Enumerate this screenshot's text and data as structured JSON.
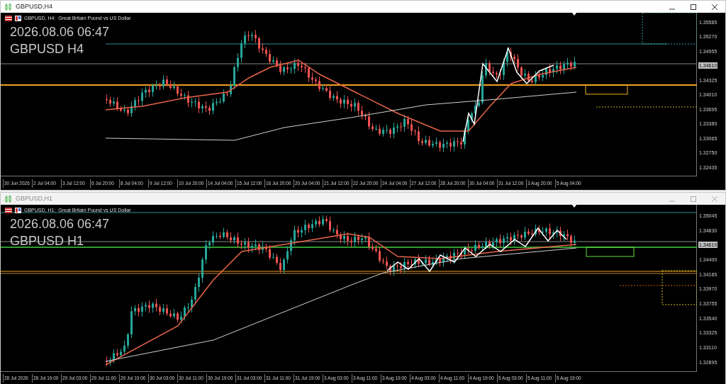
{
  "windows": [
    {
      "title": "GBPUSD,H4",
      "active": true,
      "header": "GBPUSD, H4:  Great Britain Pound vs US Dollar",
      "clock": "2026.08.06 06:47",
      "symbol_label": "GBPUSD H4",
      "price_axis": [
        {
          "kind": "tick",
          "label": "1.35585"
        },
        {
          "kind": "tick",
          "label": "1.35270"
        },
        {
          "kind": "tick",
          "label": "1.34955"
        },
        {
          "kind": "current",
          "label": "1.34610"
        },
        {
          "kind": "tick",
          "label": "1.34325"
        },
        {
          "kind": "tick",
          "label": "1.34010"
        },
        {
          "kind": "tick",
          "label": "1.33695"
        },
        {
          "kind": "tick",
          "label": "1.33380"
        },
        {
          "kind": "tick",
          "label": "1.33065"
        },
        {
          "kind": "tick",
          "label": "1.32750"
        },
        {
          "kind": "tick",
          "label": "1.32435"
        }
      ],
      "time_axis": [
        "30 Jun 2026",
        "2 Jul 04:00",
        "3 Jul 12:00",
        "6 Jul 20:00",
        "8 Jul 04:00",
        "9 Jul 12:00",
        "10 Jul 20:00",
        "14 Jul 04:00",
        "15 Jul 12:00",
        "16 Jul 20:00",
        "20 Jul 04:00",
        "21 Jul 12:00",
        "22 Jul 20:00",
        "24 Jul 04:00",
        "27 Jul 12:00",
        "28 Jul 20:00",
        "30 Jul 04:00",
        "31 Jul 12:00",
        "3 Aug 20:00",
        "5 Aug 04:00"
      ]
    },
    {
      "title": "GBPUSD,H1",
      "active": false,
      "header": "GBPUSD, H1:  Great Britain Pound vs US Dollar",
      "clock": "2026.08.06 06:47",
      "symbol_label": "GBPUSD H1",
      "price_axis": [
        {
          "kind": "tick",
          "label": "1.35045"
        },
        {
          "kind": "tick",
          "label": "1.34830"
        },
        {
          "kind": "current",
          "label": "1.34610"
        },
        {
          "kind": "tick",
          "label": "1.34400"
        },
        {
          "kind": "tick",
          "label": "1.34185"
        },
        {
          "kind": "tick",
          "label": "1.33970"
        },
        {
          "kind": "tick",
          "label": "1.33755"
        },
        {
          "kind": "tick",
          "label": "1.33540"
        },
        {
          "kind": "tick",
          "label": "1.33325"
        },
        {
          "kind": "tick",
          "label": "1.33110"
        },
        {
          "kind": "tick",
          "label": "1.32895"
        }
      ],
      "time_axis": [
        "28 Jul 2026",
        "28 Jul 19:00",
        "29 Jul 03:00",
        "29 Jul 11:00",
        "29 Jul 19:00",
        "30 Jul 03:00",
        "30 Jul 11:00",
        "30 Jul 19:00",
        "31 Jul 03:00",
        "31 Jul 11:00",
        "31 Jul 19:00",
        "3 Aug 03:00",
        "3 Aug 11:00",
        "3 Aug 19:00",
        "4 Aug 03:00",
        "4 Aug 11:00",
        "4 Aug 19:00",
        "5 Aug 03:00",
        "5 Aug 11:00",
        "5 Aug 19:00"
      ]
    }
  ]
}
